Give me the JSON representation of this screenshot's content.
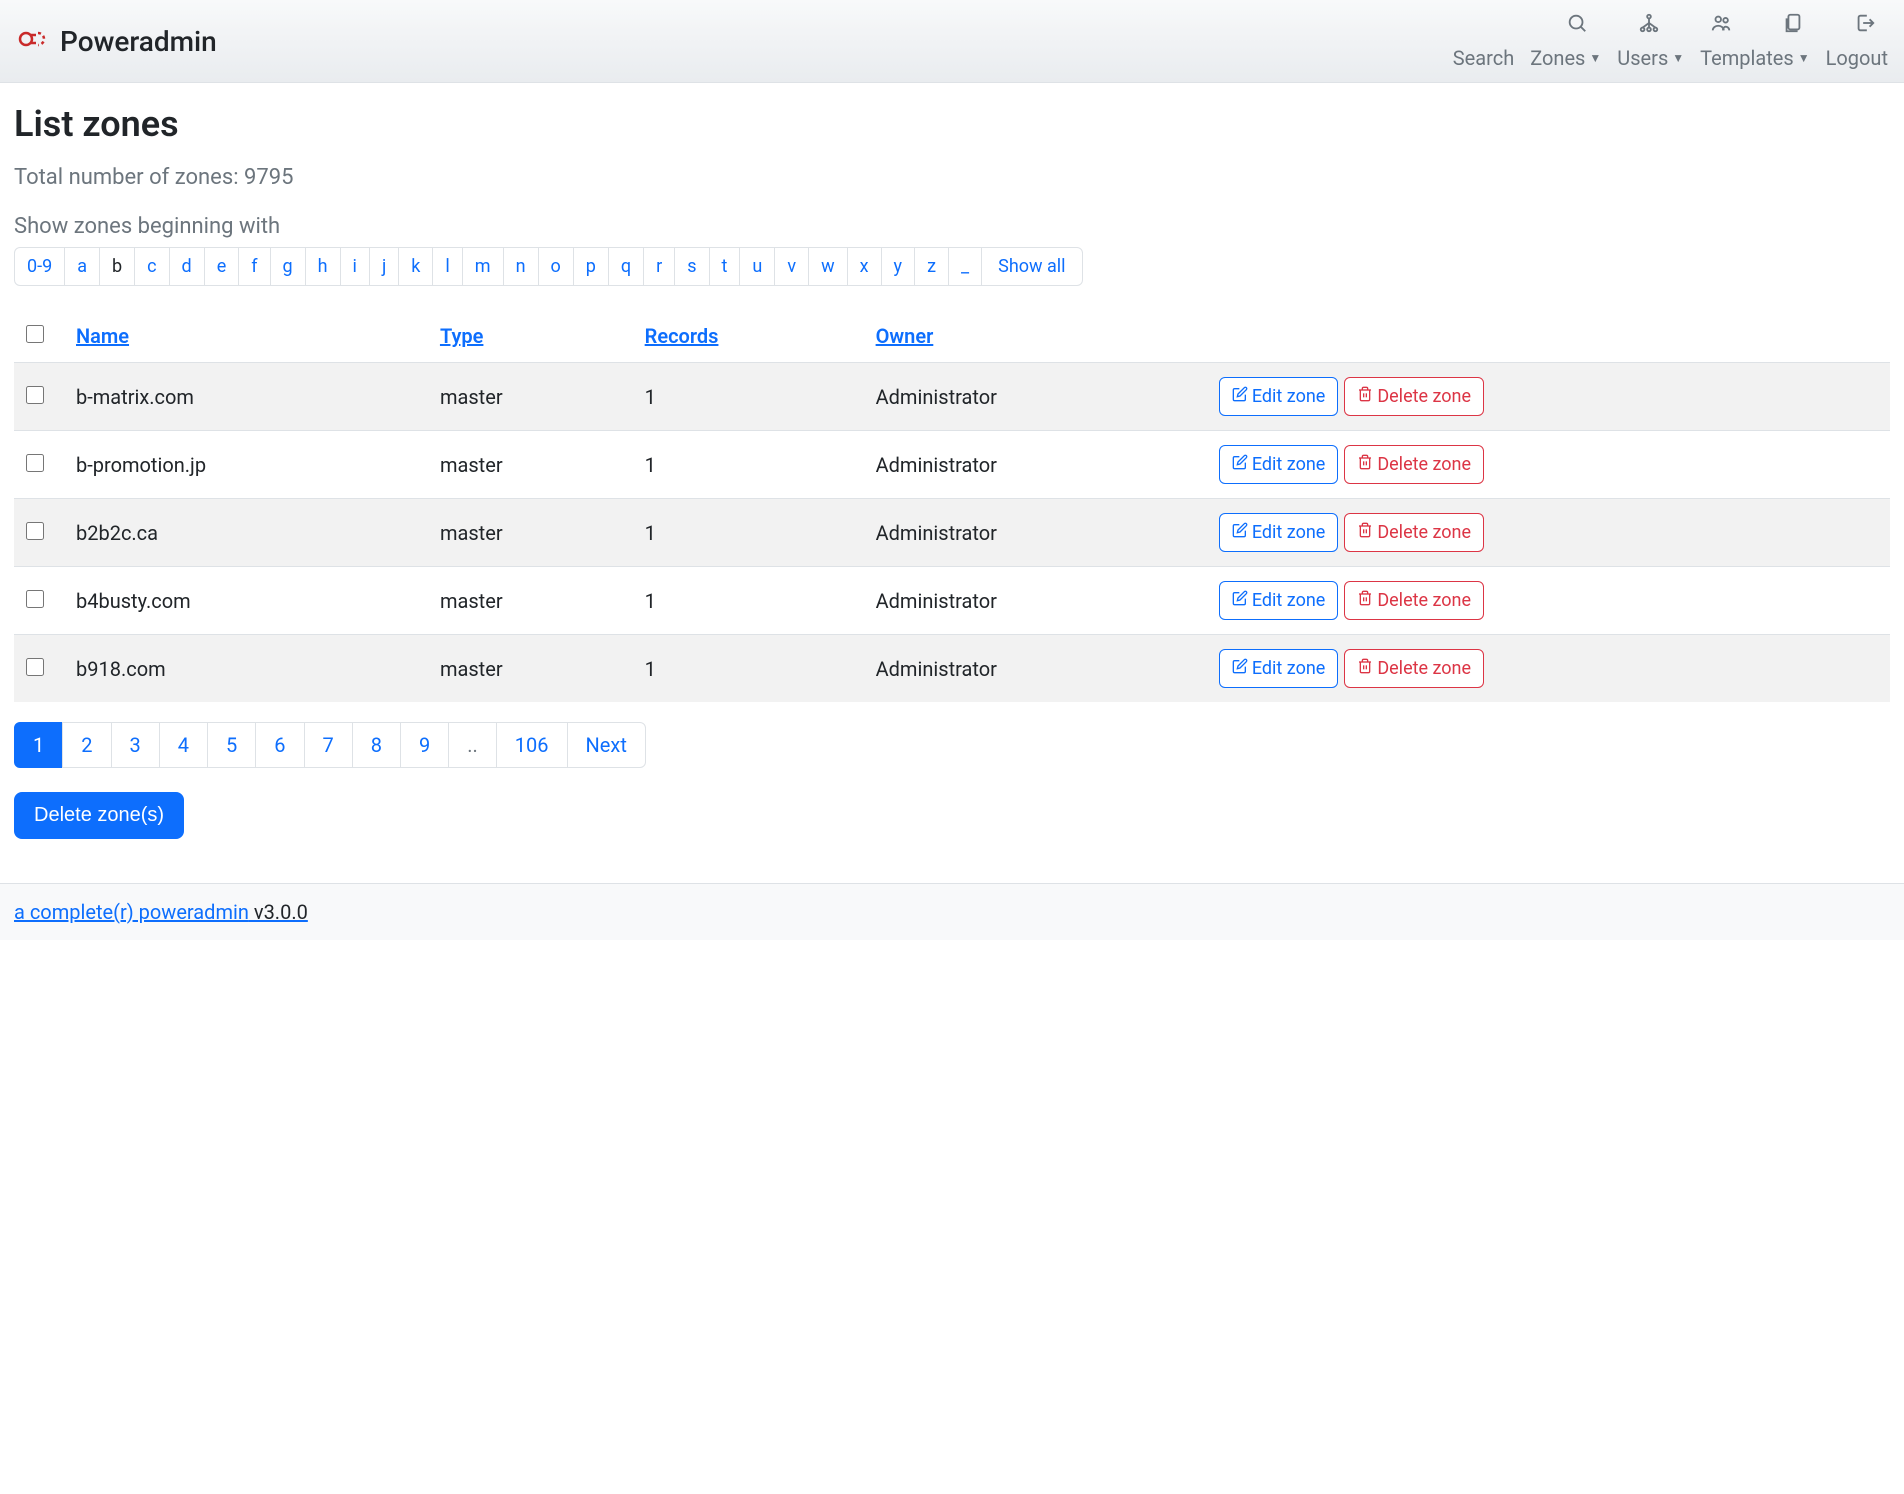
{
  "header": {
    "brand": "Poweradmin",
    "nav": {
      "search": "Search",
      "zones": "Zones",
      "users": "Users",
      "templates": "Templates",
      "logout": "Logout"
    }
  },
  "page": {
    "title": "List zones",
    "total_label": "Total number of zones: 9795",
    "filter_label": "Show zones beginning with"
  },
  "letters": {
    "num": "0-9",
    "a": "a",
    "b": "b",
    "c": "c",
    "d": "d",
    "e": "e",
    "f": "f",
    "g": "g",
    "h": "h",
    "i": "i",
    "j": "j",
    "k": "k",
    "l": "l",
    "m": "m",
    "n": "n",
    "o": "o",
    "p": "p",
    "q": "q",
    "r": "r",
    "s": "s",
    "t": "t",
    "u": "u",
    "v": "v",
    "w": "w",
    "x": "x",
    "y": "y",
    "z": "z",
    "under": "_",
    "all": "Show all"
  },
  "table": {
    "headers": {
      "name": "Name",
      "type": "Type",
      "records": "Records",
      "owner": "Owner"
    },
    "rows": [
      {
        "name": "b-matrix.com",
        "type": "master",
        "records": "1",
        "owner": "Administrator"
      },
      {
        "name": "b-promotion.jp",
        "type": "master",
        "records": "1",
        "owner": "Administrator"
      },
      {
        "name": "b2b2c.ca",
        "type": "master",
        "records": "1",
        "owner": "Administrator"
      },
      {
        "name": "b4busty.com",
        "type": "master",
        "records": "1",
        "owner": "Administrator"
      },
      {
        "name": "b918.com",
        "type": "master",
        "records": "1",
        "owner": "Administrator"
      }
    ],
    "edit_label": "Edit zone",
    "delete_label": "Delete zone"
  },
  "pagination": {
    "p1": "1",
    "p2": "2",
    "p3": "3",
    "p4": "4",
    "p5": "5",
    "p6": "6",
    "p7": "7",
    "p8": "8",
    "p9": "9",
    "ellipsis": "..",
    "last": "106",
    "next": "Next"
  },
  "actions": {
    "delete_zones": "Delete zone(s)"
  },
  "footer": {
    "link": "a complete(r) poweradmin",
    "version": " v3.0.0"
  }
}
